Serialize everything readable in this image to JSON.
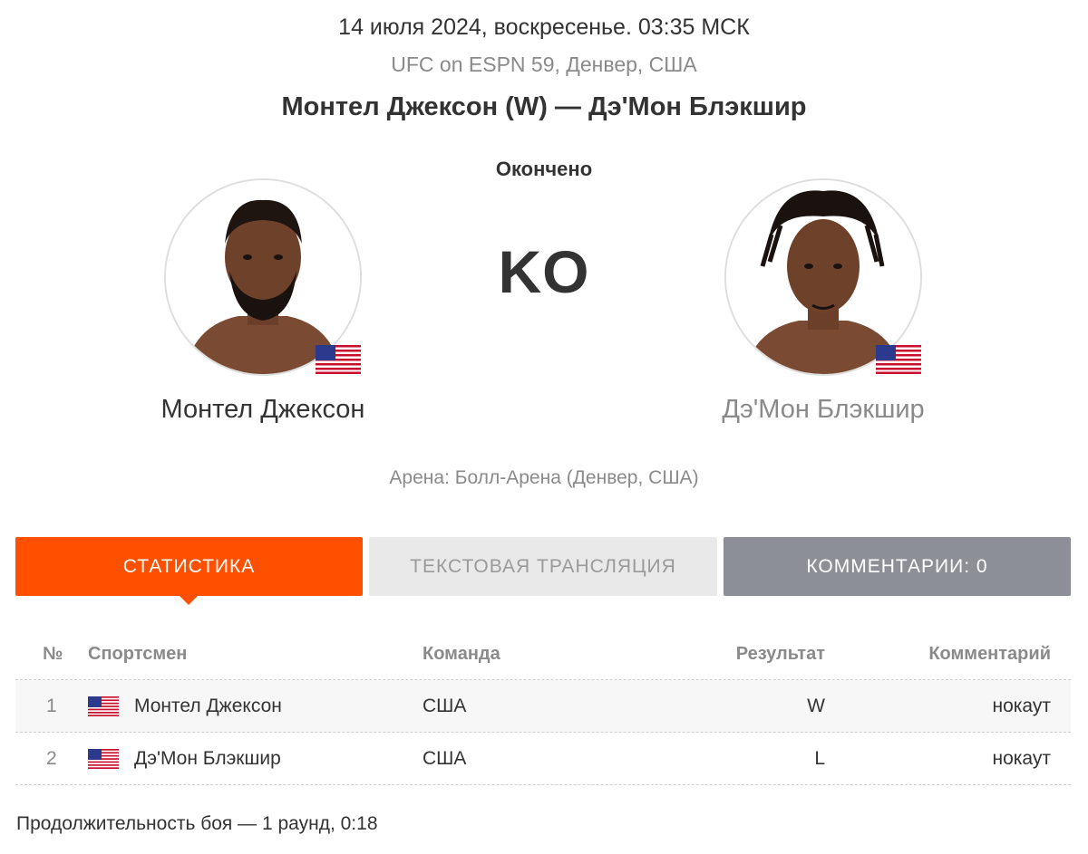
{
  "event_header": {
    "date": "14 июля 2024, воскресенье. 03:35 МСК",
    "event": "UFC on ESPN 59, Денвер, США",
    "title": "Монтел Джексон (W) — Дэ'Мон Блэкшир",
    "status": "Окончено",
    "result": "KO"
  },
  "fighters": [
    {
      "name": "Монтел Джексон",
      "flag": "us-flag-icon",
      "name_color": "#333333"
    },
    {
      "name": "Дэ'Мон Блэкшир",
      "flag": "us-flag-icon",
      "name_color": "#8a8a8a"
    }
  ],
  "arena": "Арена: Болл-Арена (Денвер, США)",
  "tabs": [
    {
      "label": "СТАТИСТИКА",
      "active": true
    },
    {
      "label": "ТЕКСТОВАЯ ТРАНСЛЯЦИЯ",
      "active": false
    },
    {
      "label": "КОММЕНТАРИИ: 0",
      "active": false
    }
  ],
  "table": {
    "headers": {
      "num": "№",
      "athlete": "Спортсмен",
      "team": "Команда",
      "result": "Результат",
      "comment": "Комментарий"
    },
    "rows": [
      {
        "num": "1",
        "athlete": "Монтел Джексон",
        "team": "США",
        "result": "W",
        "comment": "нокаут"
      },
      {
        "num": "2",
        "athlete": "Дэ'Мон Блэкшир",
        "team": "США",
        "result": "L",
        "comment": "нокаут"
      }
    ]
  },
  "duration": "Продолжительность боя — 1 раунд, 0:18",
  "colors": {
    "accent": "#ff5000",
    "muted": "#8a8a8a",
    "tab_inactive": "#e9e9e9",
    "tab_dark": "#8c9096"
  }
}
